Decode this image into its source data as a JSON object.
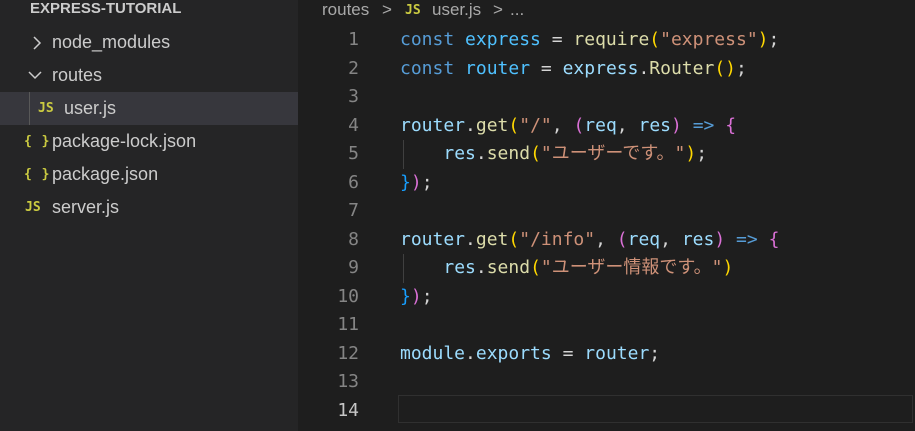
{
  "explorer": {
    "title": "EXPRESS-TUTORIAL",
    "items": [
      {
        "label": "node_modules",
        "icon": "chevron-right-icon"
      },
      {
        "label": "routes",
        "icon": "chevron-down-icon"
      },
      {
        "label": "user.js",
        "icon": "js-file-icon",
        "badge": "JS",
        "active": true
      },
      {
        "label": "package-lock.json",
        "icon": "json-file-icon",
        "badge": "{ }"
      },
      {
        "label": "package.json",
        "icon": "json-file-icon",
        "badge": "{ }"
      },
      {
        "label": "server.js",
        "icon": "js-file-icon",
        "badge": "JS"
      }
    ]
  },
  "breadcrumb": {
    "folder": "routes",
    "sep1": ">",
    "file_badge": "JS",
    "file": "user.js",
    "sep2": ">",
    "more": "..."
  },
  "editor": {
    "current_line": 14,
    "lines": [
      {
        "n": "1",
        "text": "const express = require(\"express\");"
      },
      {
        "n": "2",
        "text": "const router = express.Router();"
      },
      {
        "n": "3",
        "text": ""
      },
      {
        "n": "4",
        "text": "router.get(\"/\", (req, res) => {"
      },
      {
        "n": "5",
        "text": "    res.send(\"ユーザーです。\");"
      },
      {
        "n": "6",
        "text": "});"
      },
      {
        "n": "7",
        "text": ""
      },
      {
        "n": "8",
        "text": "router.get(\"/info\", (req, res) => {"
      },
      {
        "n": "9",
        "text": "    res.send(\"ユーザー情報です。\")"
      },
      {
        "n": "10",
        "text": "});"
      },
      {
        "n": "11",
        "text": ""
      },
      {
        "n": "12",
        "text": "module.exports = router;"
      },
      {
        "n": "13",
        "text": ""
      },
      {
        "n": "14",
        "text": ""
      }
    ]
  },
  "colors": {
    "editor_bg": "#1e1e1e",
    "sidebar_bg": "#252526",
    "active_row_bg": "#37373d",
    "keyword": "#569cd6",
    "string": "#ce9178",
    "function": "#dcdcaa",
    "variable": "#9cdcfe"
  }
}
